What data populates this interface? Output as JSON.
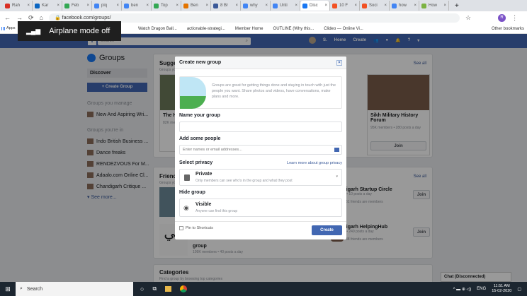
{
  "browser": {
    "tabs": [
      {
        "label": "Rah",
        "color": "#d93025"
      },
      {
        "label": "Kar",
        "color": "#0a66c2"
      },
      {
        "label": "Feb",
        "color": "#34a853"
      },
      {
        "label": "piq",
        "color": "#4285f4"
      },
      {
        "label": "ben",
        "color": "#4285f4"
      },
      {
        "label": "Top",
        "color": "#34a853"
      },
      {
        "label": "Ben",
        "color": "#e37400"
      },
      {
        "label": "8 Br",
        "color": "#3b5998"
      },
      {
        "label": "why",
        "color": "#4285f4"
      },
      {
        "label": "Unti",
        "color": "#4285f4"
      },
      {
        "label": "Disc",
        "color": "#1877f2",
        "active": true
      },
      {
        "label": "10 F",
        "color": "#f25022"
      },
      {
        "label": "Soci",
        "color": "#f25022"
      },
      {
        "label": "how",
        "color": "#4285f4"
      },
      {
        "label": "How",
        "color": "#7cb342"
      }
    ],
    "url": "facebook.com/groups/",
    "profile_initial": "R",
    "bookmarks": [
      "Watch Dragon Ball...",
      "actionable-strategi...",
      "Member Home",
      "OUTLINE (Why this...",
      "Clideo — Online Vi..."
    ],
    "apps_label": "Apps",
    "other_bookmarks": "Other bookmarks"
  },
  "toast": "Airplane mode off",
  "fb": {
    "search_placeholder": "Search",
    "user": "S.",
    "home": "Home",
    "create": "Create"
  },
  "sidebar": {
    "title": "Groups",
    "discover": "Discover",
    "create_group": "+ Create Group",
    "manage_heading": "Groups you manage",
    "managed": [
      "New And Aspiring Wri..."
    ],
    "in_heading": "Groups you're in",
    "groups": [
      "Indo British Business ...",
      "Dance freaks",
      "RENDEZVOUS For M...",
      "Adaalo.com Online Cl...",
      "Chandigarh Critique ..."
    ],
    "see_more": "See more..."
  },
  "suggested": {
    "title": "Suggested for You",
    "subtitle": "Groups you might be interested in",
    "see_all": "See all",
    "cards": [
      {
        "name": "The H...",
        "meta": "82K members • day"
      },
      {
        "name": "Sikh Military History Forum",
        "meta": "95K members • 280 posts a day",
        "join": "Join"
      }
    ]
  },
  "friends": {
    "title": "Friends' Groups",
    "subtitle": "Groups your friends are in",
    "see_all": "See all",
    "items": [
      {
        "name": "Chandigarh Startup Circle",
        "meta": "members • 10 posts a day",
        "friends": "61 friends are members",
        "join": "Join"
      },
      {
        "name": "Chandigarh HelpingHub",
        "meta": "members • 240 posts a day",
        "friends": "38 friends are members",
        "join": "Join"
      },
      {
        "name": "group",
        "meta": "109K members • 40 posts a day"
      }
    ]
  },
  "categories": {
    "title": "Categories",
    "subtitle": "Find a group by browsing top categories"
  },
  "chat": "Chat (Disconnected)",
  "modal": {
    "title": "Create new group",
    "intro": "Groups are great for getting things done and staying in touch with just the people you want. Share photos and videos, have conversations, make plans and more.",
    "name_label": "Name your group",
    "name_value": "",
    "people_label": "Add some people",
    "people_placeholder": "Enter names or email addresses...",
    "privacy_label": "Select privacy",
    "privacy_link": "Learn more about group privacy",
    "privacy_value": "Private",
    "privacy_desc": "Only members can see who's in the group and what they post",
    "hide_label": "Hide group",
    "hide_value": "Visible",
    "hide_desc": "Anyone can find this group",
    "pin_label": "Pin to Shortcuts",
    "create": "Create"
  },
  "taskbar": {
    "search": "Search",
    "lang": "ENG",
    "time": "11:51 AM",
    "date": "15-02-2020"
  }
}
